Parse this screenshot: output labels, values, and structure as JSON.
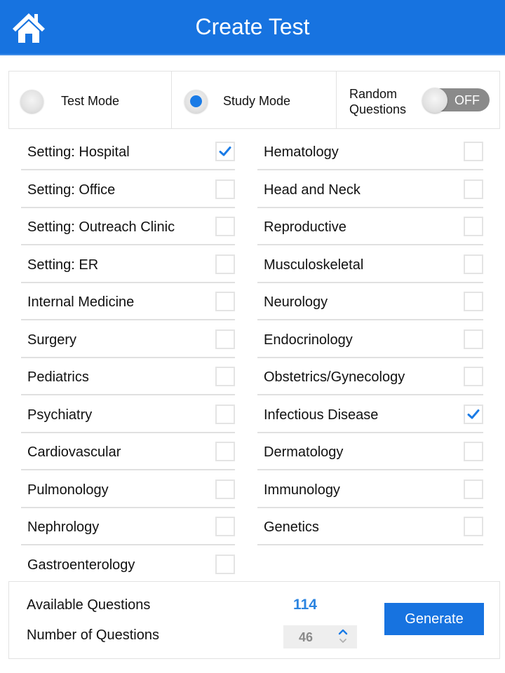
{
  "header": {
    "title": "Create Test",
    "home_icon": "home-icon",
    "background_color": "#1773e0"
  },
  "modes": {
    "test_mode": {
      "label": "Test Mode",
      "selected": false
    },
    "study_mode": {
      "label": "Study Mode",
      "selected": true
    },
    "random_questions": {
      "label_line1": "Random",
      "label_line2": "Questions",
      "toggle_text": "OFF",
      "on": false
    }
  },
  "categories": {
    "left": [
      {
        "label": "Setting: Hospital",
        "checked": true
      },
      {
        "label": "Setting: Office",
        "checked": false
      },
      {
        "label": "Setting: Outreach Clinic",
        "checked": false
      },
      {
        "label": "Setting: ER",
        "checked": false
      },
      {
        "label": "Internal Medicine",
        "checked": false
      },
      {
        "label": "Surgery",
        "checked": false
      },
      {
        "label": "Pediatrics",
        "checked": false
      },
      {
        "label": "Psychiatry",
        "checked": false
      },
      {
        "label": "Cardiovascular",
        "checked": false
      },
      {
        "label": "Pulmonology",
        "checked": false
      },
      {
        "label": "Nephrology",
        "checked": false
      },
      {
        "label": "Gastroenterology",
        "checked": false
      }
    ],
    "right": [
      {
        "label": "Hematology",
        "checked": false
      },
      {
        "label": "Head and Neck",
        "checked": false
      },
      {
        "label": "Reproductive",
        "checked": false
      },
      {
        "label": "Musculoskeletal",
        "checked": false
      },
      {
        "label": "Neurology",
        "checked": false
      },
      {
        "label": "Endocrinology",
        "checked": false
      },
      {
        "label": "Obstetrics/Gynecology",
        "checked": false
      },
      {
        "label": "Infectious Disease",
        "checked": true
      },
      {
        "label": "Dermatology",
        "checked": false
      },
      {
        "label": "Immunology",
        "checked": false
      },
      {
        "label": "Genetics",
        "checked": false
      }
    ]
  },
  "summary": {
    "available_label": "Available Questions",
    "available_value": "114",
    "number_label": "Number of Questions",
    "number_value": "46",
    "generate_label": "Generate",
    "accent_color": "#2b84e0"
  }
}
